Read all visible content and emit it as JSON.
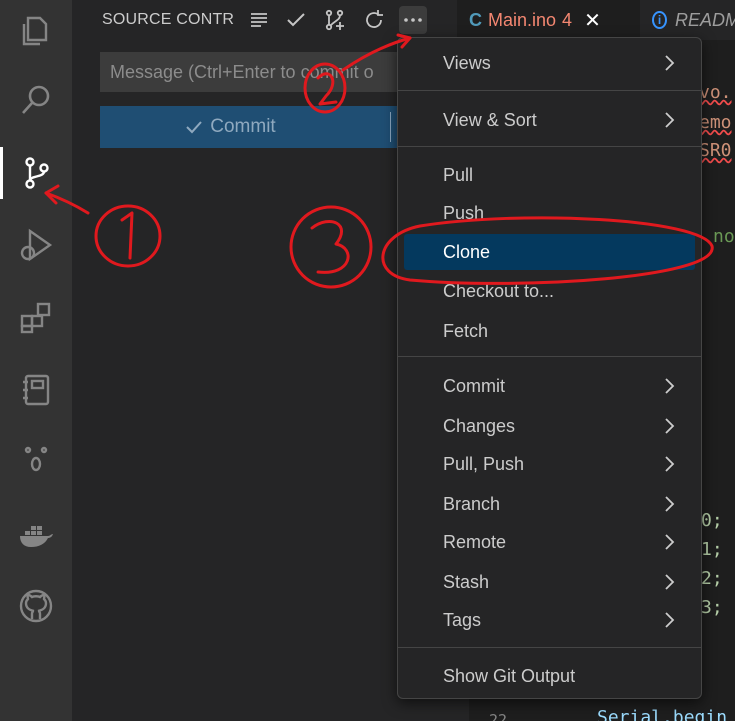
{
  "sidebar": {
    "title": "SOURCE CONTR...",
    "message_placeholder": "Message (Ctrl+Enter to commit o",
    "commit_label": "Commit"
  },
  "tabs": {
    "main": {
      "lang": "C",
      "name": "Main.ino",
      "problems": "4",
      "close": "✕"
    },
    "readme": {
      "name": "READM"
    }
  },
  "editor": {
    "snippets": [
      "vo.",
      "emo",
      "SR0",
      "no",
      "0;",
      "1;",
      "2;",
      "3;",
      "Serial.begin",
      "22"
    ]
  },
  "menu": {
    "items": [
      {
        "label": "Views",
        "submenu": true
      },
      {
        "label": "View & Sort",
        "submenu": true
      },
      {
        "label": "Pull",
        "submenu": false
      },
      {
        "label": "Push",
        "submenu": false
      },
      {
        "label": "Clone",
        "submenu": false,
        "highlighted": true
      },
      {
        "label": "Checkout to...",
        "submenu": false
      },
      {
        "label": "Fetch",
        "submenu": false
      },
      {
        "label": "Commit",
        "submenu": true
      },
      {
        "label": "Changes",
        "submenu": true
      },
      {
        "label": "Pull, Push",
        "submenu": true
      },
      {
        "label": "Branch",
        "submenu": true
      },
      {
        "label": "Remote",
        "submenu": true
      },
      {
        "label": "Stash",
        "submenu": true
      },
      {
        "label": "Tags",
        "submenu": true
      },
      {
        "label": "Show Git Output",
        "submenu": false
      }
    ]
  },
  "activity_bar": {
    "icons": [
      "explorer-icon",
      "search-icon",
      "source-control-icon",
      "run-debug-icon",
      "extensions-icon",
      "notebook-icon",
      "face-icon",
      "docker-icon",
      "github-icon"
    ]
  },
  "colors": {
    "accent": "#04395e",
    "annotation": "#e0191e",
    "commit_button": "#1f4e73"
  }
}
